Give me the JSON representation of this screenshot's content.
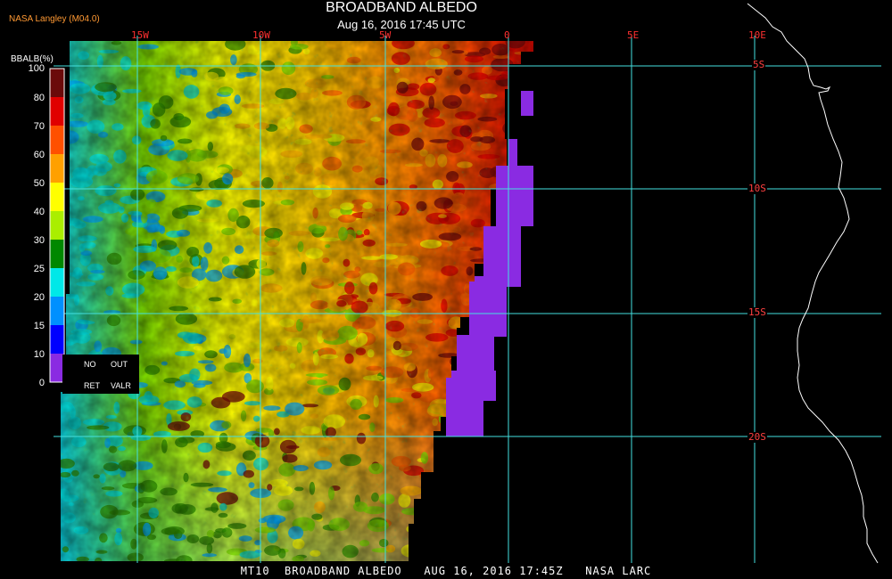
{
  "header": {
    "title": "BROADBAND ALBEDO",
    "subtitle": "Aug 16, 2016 17:45 UTC",
    "producer": "NASA Langley (M04.0)"
  },
  "footer": {
    "text": "MT10  BROADBAND ALBEDO   AUG 16, 2016 17:45Z   NASA LARC"
  },
  "grid": {
    "lon_labels": [
      "15W",
      "10W",
      "5W",
      "0",
      "5E",
      "10E"
    ],
    "lat_labels": [
      "5S",
      "10S",
      "15S",
      "20S"
    ],
    "line_color": "#44e0e0"
  },
  "legend": {
    "title": "BBALB(%)",
    "ticks": [
      "100",
      "80",
      "70",
      "60",
      "50",
      "40",
      "30",
      "25",
      "20",
      "15",
      "10",
      "0"
    ],
    "colors": [
      "#6b0a0a",
      "#e00000",
      "#ff5000",
      "#ffa000",
      "#ffff00",
      "#aaee00",
      "#008800",
      "#00e8e8",
      "#0090ff",
      "#0000ff",
      "#8a2be2"
    ],
    "no_ret_label_1": "NO",
    "no_ret_label_2": "RET",
    "out_valr_label_1": "OUT",
    "out_valr_label_2": "VALR",
    "no_retrieval_color": "#8a2be2"
  },
  "colors": {
    "background": "#000000",
    "coastline": "#ffffff",
    "label_red": "#ff4040",
    "producer_orange": "#ff9933"
  }
}
